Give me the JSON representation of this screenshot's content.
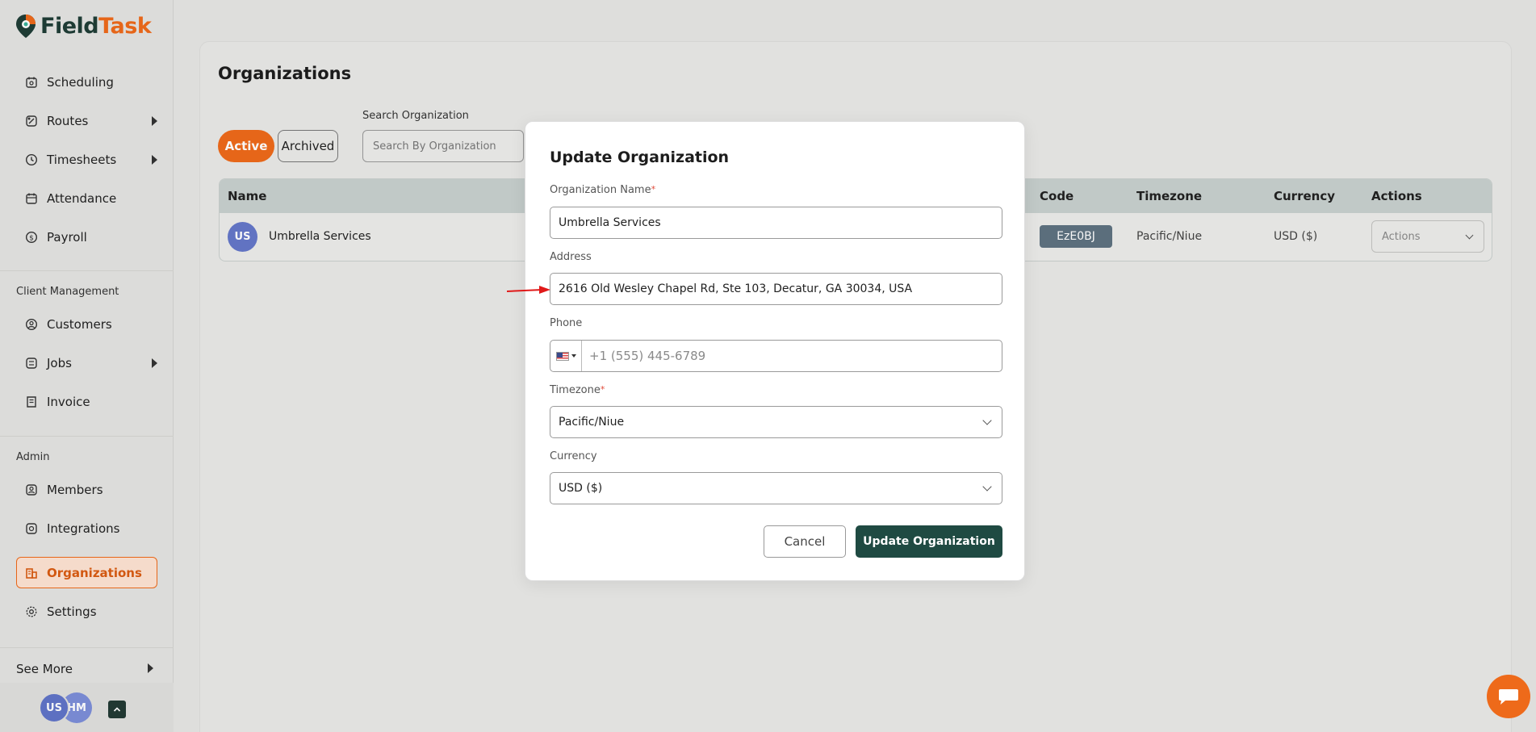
{
  "app": {
    "logo_part1": "Field",
    "logo_part2": "Task",
    "brand_color": "#ee6a1a",
    "primary_color": "#1f4a42"
  },
  "sidebar": {
    "items": [
      {
        "label": "Scheduling",
        "icon": "calendar-icon"
      },
      {
        "label": "Routes",
        "icon": "route-icon"
      },
      {
        "label": "Timesheets",
        "icon": "clock-icon"
      },
      {
        "label": "Attendance",
        "icon": "attendance-icon"
      },
      {
        "label": "Payroll",
        "icon": "payroll-icon"
      }
    ],
    "client_section": "Client Management",
    "client_items": [
      {
        "label": "Customers",
        "icon": "user-circle-icon"
      },
      {
        "label": "Jobs",
        "icon": "jobs-icon"
      },
      {
        "label": "Invoice",
        "icon": "invoice-icon"
      }
    ],
    "admin_section": "Admin",
    "admin_items": [
      {
        "label": "Members",
        "icon": "members-icon"
      },
      {
        "label": "Integrations",
        "icon": "integrations-icon"
      },
      {
        "label": "Organizations",
        "icon": "organizations-icon"
      },
      {
        "label": "Settings",
        "icon": "gear-icon"
      }
    ],
    "see_more": "See More",
    "avatars": [
      "US",
      "HM"
    ]
  },
  "page": {
    "title": "Organizations",
    "tabs": [
      "Active",
      "Archived"
    ],
    "search_label": "Search Organization",
    "search_placeholder": "Search By Organization"
  },
  "table": {
    "headers": [
      "Name",
      "Code",
      "Timezone",
      "Currency",
      "Actions"
    ],
    "rows": [
      {
        "avatar": "US",
        "name": "Umbrella Services",
        "code": "EzE0BJ",
        "timezone": "Pacific/Niue",
        "currency": "USD ($)",
        "actions": "Actions"
      }
    ]
  },
  "modal": {
    "title": "Update Organization",
    "org_name_label": "Organization Name",
    "org_name_value": "Umbrella Services",
    "address_label": "Address",
    "address_value": "2616 Old Wesley Chapel Rd, Ste 103, Decatur, GA 30034, USA",
    "phone_label": "Phone",
    "phone_placeholder": "+1 (555) 445-6789",
    "timezone_label": "Timezone",
    "timezone_value": "Pacific/Niue",
    "currency_label": "Currency",
    "currency_value": "USD ($)",
    "required_mark": "*",
    "cancel_label": "Cancel",
    "update_label": "Update Organization"
  }
}
